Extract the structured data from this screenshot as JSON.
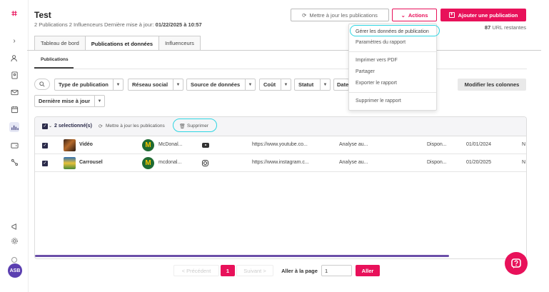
{
  "header": {
    "title": "Test",
    "stats_left": "2 Publications  2 Influenceurs  Dernière mise à jour: ",
    "last_update": "01/22/2025 à 10:57",
    "update_button": "Mettre à jour les publications",
    "actions_button": "Actions",
    "add_button": "Ajouter une publication",
    "url_count": "87",
    "url_label": " URL restantes"
  },
  "tabs": [
    {
      "label": "Tableau de bord"
    },
    {
      "label": "Publications et données"
    },
    {
      "label": "Influenceurs"
    }
  ],
  "subtab": {
    "label": "Publications"
  },
  "filters": [
    {
      "label": "Type de publication"
    },
    {
      "label": "Réseau social"
    },
    {
      "label": "Source de données"
    },
    {
      "label": "Coût"
    },
    {
      "label": "Statut"
    },
    {
      "label": "Date"
    },
    {
      "label": "Dernière mise à jour"
    }
  ],
  "modify_columns": "Modifier les colonnes",
  "bulk_bar": {
    "selected": "2 selectionné(s)",
    "update": "Mettre à jour les publications",
    "delete": "Supprimer"
  },
  "rows": [
    {
      "name": "Vidéo",
      "influencer": "McDonal...",
      "network_icon": "youtube-icon",
      "url": "https://www.youtube.co...",
      "analysis": "Analyse au...",
      "status": "Dispon...",
      "date": "01/01/2024",
      "extra": "N"
    },
    {
      "name": "Carrousel",
      "influencer": "mcdonal...",
      "network_icon": "instagram-icon",
      "url": "https://www.instagram.c...",
      "analysis": "Analyse au...",
      "status": "Dispon...",
      "date": "01/20/2025",
      "extra": "N"
    }
  ],
  "actions_menu": [
    {
      "label": "Gérer les données de publication"
    },
    {
      "label": "Paramètres du rapport"
    },
    {
      "label": "Imprimer vers PDF"
    },
    {
      "label": "Partager"
    },
    {
      "label": "Exporter le rapport"
    },
    {
      "label": "Supprimer le rapport"
    }
  ],
  "pagination": {
    "prev": "< Précédent",
    "current": "1",
    "next": "Suivant >",
    "goto_label": "Aller à la page",
    "goto_value": "1",
    "go_button": "Aller"
  },
  "user": {
    "initials": "ASB"
  },
  "colors": {
    "accent": "#e8115a",
    "primary_dark": "#2b2b4a",
    "highlight": "#2fd5e2",
    "scrollbar": "#6b4fa8"
  }
}
